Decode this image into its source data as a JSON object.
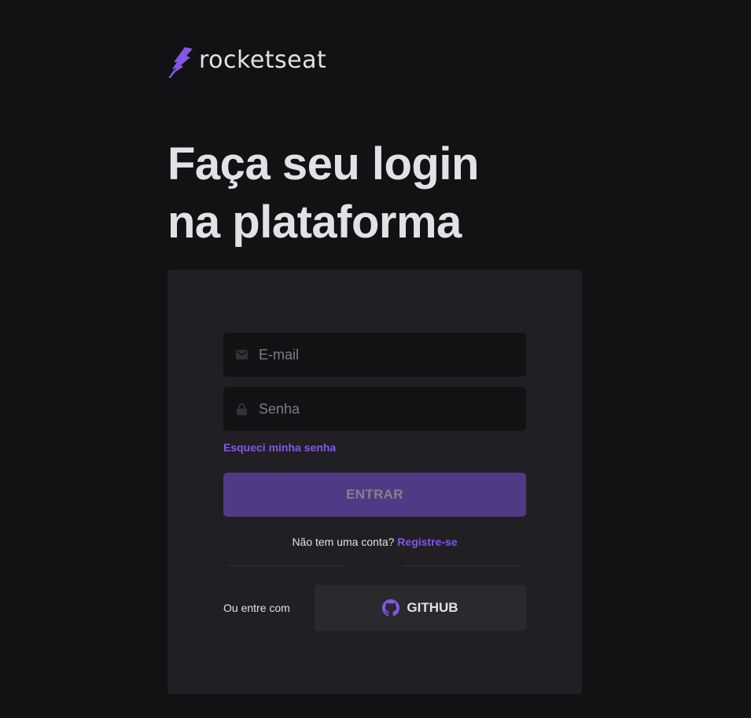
{
  "logo": {
    "text": "rocketseat"
  },
  "headline": {
    "line1": "Faça seu login",
    "line2": "na plataforma"
  },
  "form": {
    "email_placeholder": "E-mail",
    "password_placeholder": "Senha",
    "forgot_label": "Esqueci minha senha",
    "submit_label": "ENTRAR",
    "register_prompt": "Não tem uma conta?",
    "register_link": "Registre-se",
    "alt_login_label": "Ou entre com",
    "github_label": "GITHUB"
  },
  "icons": {
    "logo": "rocket-icon",
    "email": "envelope-icon",
    "password": "lock-icon",
    "github": "github-icon"
  },
  "colors": {
    "background": "#121214",
    "card": "#202024",
    "accent": "#8257e5",
    "submit_button": "#503a85",
    "github_button": "#29292e",
    "text": "#e1e1e6"
  }
}
